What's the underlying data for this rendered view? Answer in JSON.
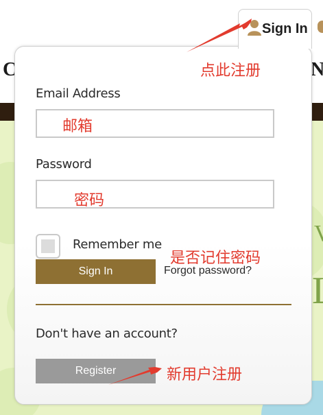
{
  "header": {
    "sign_in_tab_label": "Sign In",
    "brand_left_fragment": "C",
    "brand_right_fragment": "N"
  },
  "background": {
    "green_letters": [
      "V",
      "L"
    ]
  },
  "login_form": {
    "email_label": "Email Address",
    "email_placeholder": "",
    "password_label": "Password",
    "password_placeholder": "",
    "remember_me_label": "Remember me",
    "remember_me_checked": false,
    "sign_in_button": "Sign In",
    "forgot_password_link": "Forgot password?",
    "no_account_text": "Don't have an account?",
    "register_button": "Register"
  },
  "annotations": {
    "click_to_register": "点此注册",
    "email": "邮箱",
    "password": "密码",
    "remember_password": "是否记住密码",
    "new_user_register": "新用户注册"
  },
  "colors": {
    "accent_brown": "#8e7033",
    "annotation_red": "#e23b2e",
    "register_gray": "#9a9a9a",
    "header_band": "#2f1e0f",
    "background_green": "#e9f3c6"
  },
  "icons": {
    "user": "user-icon"
  }
}
